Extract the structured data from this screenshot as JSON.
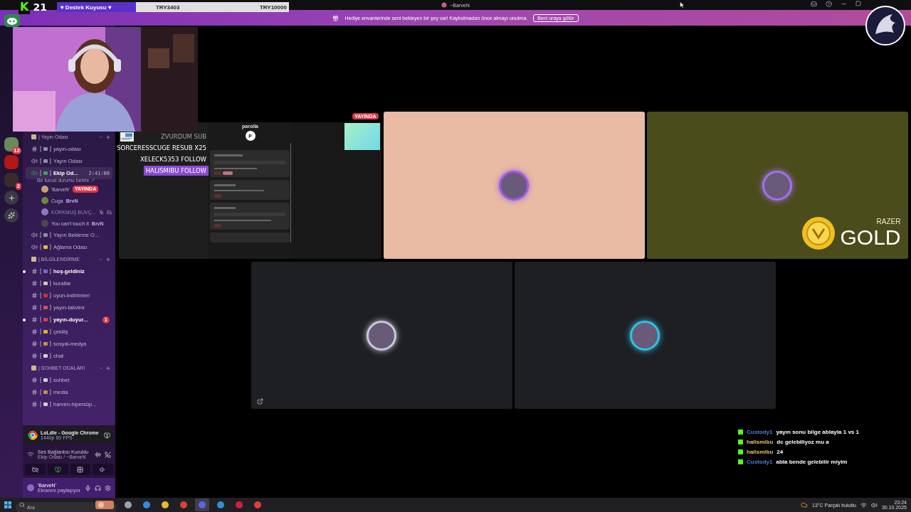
{
  "window": {
    "title": "~BarveN"
  },
  "goal": {
    "logo": "K",
    "count": "21",
    "title": "♥ Destek Kuyusu ♥",
    "current": "TRY3403",
    "target": "TRY10000"
  },
  "banner": {
    "text": "Hediye envanterinde seni bekleyen bir şey var! Kaybolmadan önce almayı unutma.",
    "button": "Beni oraya götür"
  },
  "servers": [
    {
      "kind": "server",
      "color": "#6a8a5a",
      "badge": "12"
    },
    {
      "kind": "server",
      "color": "#b01818"
    },
    {
      "kind": "server",
      "color": "#3a2a2a",
      "badge": "2"
    },
    {
      "kind": "add",
      "color": "#3a3a44"
    },
    {
      "kind": "discover",
      "color": "#3a3a44"
    }
  ],
  "categories": [
    {
      "name": "| Yayın Odası",
      "channels": [
        {
          "kind": "text",
          "name": "yayın-odası",
          "color": "#8a8fa8",
          "selected": false,
          "unread": false
        },
        {
          "kind": "voice",
          "name": "Yayın Odası",
          "color": "#8a8fa8",
          "selected": false,
          "unread": false
        },
        {
          "kind": "voice",
          "name": "Ekip Od...",
          "color": "#3aa55a",
          "selected": true,
          "unread": false,
          "timer": "2:41:00",
          "status": "Bir kanal durumu belirle",
          "members": [
            {
              "name": "'BarveN'",
              "color": "#c9a070",
              "muted": false,
              "badge": "YAYINDA"
            },
            {
              "name": "Cuga",
              "color": "#6a8a3a",
              "muted": false,
              "tag": "BrvN"
            },
            {
              "name": "KORKMUŞ BUVÇ...",
              "color": "#8a7ac0",
              "muted": true
            },
            {
              "name": "You can't touch it",
              "color": "#4a4a4a",
              "muted": false,
              "tag": "BrvN"
            }
          ]
        },
        {
          "kind": "voice",
          "name": "Yayın Bekleme O...",
          "color": "#8a8fa8",
          "selected": false,
          "unread": false
        },
        {
          "kind": "voice",
          "name": "Ağlama Odası",
          "color": "#e0c040",
          "selected": false,
          "unread": false
        }
      ]
    },
    {
      "name": "| BİLGİLENDİRME",
      "channels": [
        {
          "kind": "text",
          "name": "hoş-geldiniz",
          "color": "#7a6ad0",
          "selected": false,
          "unread": true
        },
        {
          "kind": "text",
          "name": "kurallar",
          "color": "#d0c8b0",
          "selected": false,
          "unread": false
        },
        {
          "kind": "text",
          "name": "oyun-indirimleri",
          "color": "#d03030",
          "selected": false,
          "unread": false
        },
        {
          "kind": "text",
          "name": "yayın-takvimi",
          "color": "#e05050",
          "selected": false,
          "unread": false
        },
        {
          "kind": "text",
          "name": "yayın-duyur...",
          "color": "#e04050",
          "selected": false,
          "unread": true,
          "mentions": "1"
        },
        {
          "kind": "text",
          "name": "çekiliş",
          "color": "#e0b030",
          "selected": false,
          "unread": false
        },
        {
          "kind": "text",
          "name": "sosyal-medya",
          "color": "#c09050",
          "selected": false,
          "unread": false
        },
        {
          "kind": "text",
          "name": "chat",
          "color": "#d0d0d8",
          "selected": false,
          "unread": false
        }
      ]
    },
    {
      "name": "| SOHBET ODALARI",
      "channels": [
        {
          "kind": "text",
          "name": "sohbet",
          "color": "#d0d0d8",
          "selected": false,
          "unread": false
        },
        {
          "kind": "text",
          "name": "media",
          "color": "#c09050",
          "selected": false,
          "unread": false
        },
        {
          "kind": "text",
          "name": "barven-hipersüp...",
          "color": "#d0d0d8",
          "selected": false,
          "unread": false
        }
      ]
    }
  ],
  "activity": {
    "app": "LoLdle - Google Chrome",
    "quality": "1440p 60 FPS"
  },
  "voice": {
    "status": "Ses Bağlantısı Kuruldu",
    "channel": "Ekip Odası / ~BarveN"
  },
  "user": {
    "name": "'BarveN'",
    "status": "Ekranını paylaşıyor"
  },
  "alerts": [
    {
      "text": "ZVURDUM SUB",
      "faded": true,
      "highlight": false
    },
    {
      "text": "SORCERESSCUGE RESUB X25",
      "faded": false,
      "highlight": false
    },
    {
      "text": "XELECK5353 FOLLOW",
      "faded": false,
      "highlight": false
    },
    {
      "text": "HALISMIBU FOLLOW",
      "faded": false,
      "highlight": true
    }
  ],
  "tile_rows": [
    [
      {
        "kind": "screen",
        "live_badge": "YAYINDA",
        "site": "parolla",
        "site_letter": "P"
      },
      {
        "kind": "avatar",
        "color": "#e9bba4",
        "avatar": {
          "color": "#9a5be0"
        },
        "popout": false
      },
      {
        "kind": "avatar",
        "color": "#4b4c1c",
        "avatar": {
          "color": "#a070f0"
        },
        "popout": false,
        "sponsor": {
          "brand": "RAZER",
          "name": "GOLD"
        }
      }
    ],
    [
      {
        "kind": "avatar",
        "color": "#1e1f22",
        "avatar": {
          "color": "#c8c8d8"
        },
        "popout": true
      },
      {
        "kind": "avatar",
        "color": "#1e1f22",
        "avatar": {
          "color": "#30c0e0"
        },
        "popout": false
      }
    ]
  ],
  "chat": [
    {
      "user": "Custody1",
      "color": "#4f7fd6",
      "text": "yayın sonu bilge ablayla 1 vs 1"
    },
    {
      "user": "halismibu",
      "color": "#e2c36a",
      "text": "dc gelebiliyoz mu a"
    },
    {
      "user": "halismibu",
      "color": "#e2c36a",
      "text": "24"
    },
    {
      "user": "Custody1",
      "color": "#4f7fd6",
      "text": "abla bende gelebilir miyim"
    }
  ],
  "taskbar": {
    "search_placeholder": "Ara",
    "apps": [
      {
        "color": "#9aa0b0",
        "selected": false
      },
      {
        "color": "#2f8ae0",
        "selected": false
      },
      {
        "color": "#e8b830",
        "selected": false
      },
      {
        "color": "#e04030",
        "selected": false
      },
      {
        "color": "#5865f2",
        "selected": true
      },
      {
        "color": "#3a8ad0",
        "selected": false
      },
      {
        "color": "#d02040",
        "selected": false
      },
      {
        "color": "#e04030",
        "selected": false
      }
    ],
    "weather": "13°C Parçalı bulutlu",
    "time": "23:24",
    "date": "30.10.2025"
  }
}
